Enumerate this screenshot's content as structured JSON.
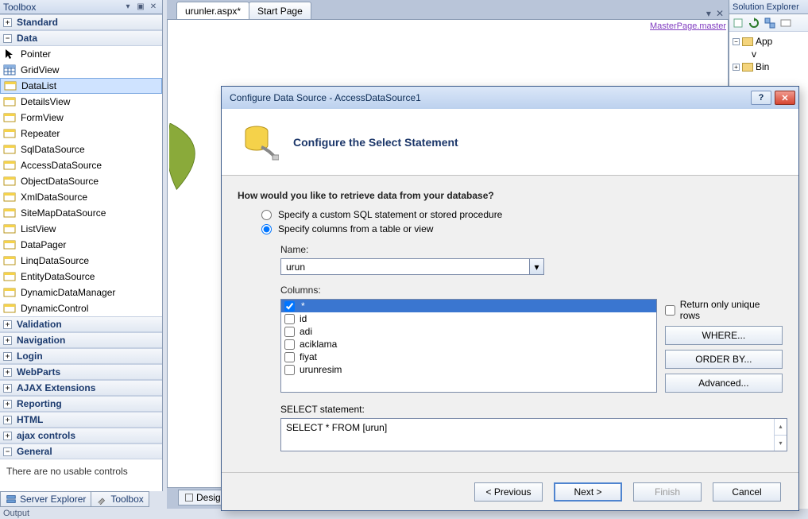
{
  "toolbox": {
    "title": "Toolbox",
    "groups": {
      "standard": "Standard",
      "data": "Data",
      "validation": "Validation",
      "navigation": "Navigation",
      "login": "Login",
      "webparts": "WebParts",
      "ajax": "AJAX Extensions",
      "reporting": "Reporting",
      "html": "HTML",
      "ajaxcontrols": "ajax controls",
      "general": "General"
    },
    "data_items": [
      "Pointer",
      "GridView",
      "DataList",
      "DetailsView",
      "FormView",
      "Repeater",
      "SqlDataSource",
      "AccessDataSource",
      "ObjectDataSource",
      "XmlDataSource",
      "SiteMapDataSource",
      "ListView",
      "DataPager",
      "LinqDataSource",
      "EntityDataSource",
      "DynamicDataManager",
      "DynamicControl"
    ],
    "no_controls": "There are no usable controls",
    "tabs": {
      "server_explorer": "Server Explorer",
      "toolbox": "Toolbox"
    },
    "output": "Output"
  },
  "doc": {
    "tabs": {
      "active": "urunler.aspx*",
      "start": "Start Page"
    },
    "master": "MasterPage.master",
    "design_tab": "Desig"
  },
  "sol": {
    "title": "Solution Explorer",
    "nodes": {
      "app": "App",
      "v": "v",
      "bin": "Bin"
    }
  },
  "dialog": {
    "title": "Configure Data Source - AccessDataSource1",
    "heading": "Configure the Select Statement",
    "question": "How would you like to retrieve data from your database?",
    "opt_custom": "Specify a custom SQL statement or stored procedure",
    "opt_columns": "Specify columns from a table or view",
    "name_label": "Name:",
    "name_value": "urun",
    "columns_label": "Columns:",
    "columns": [
      "*",
      "id",
      "adi",
      "aciklama",
      "fiyat",
      "urunresim"
    ],
    "unique_label": "Return only unique rows",
    "where_btn": "WHERE...",
    "orderby_btn": "ORDER BY...",
    "advanced_btn": "Advanced...",
    "stmt_label": "SELECT statement:",
    "stmt_value": "SELECT * FROM [urun]",
    "buttons": {
      "prev": "< Previous",
      "next": "Next >",
      "finish": "Finish",
      "cancel": "Cancel"
    },
    "help": "?"
  }
}
